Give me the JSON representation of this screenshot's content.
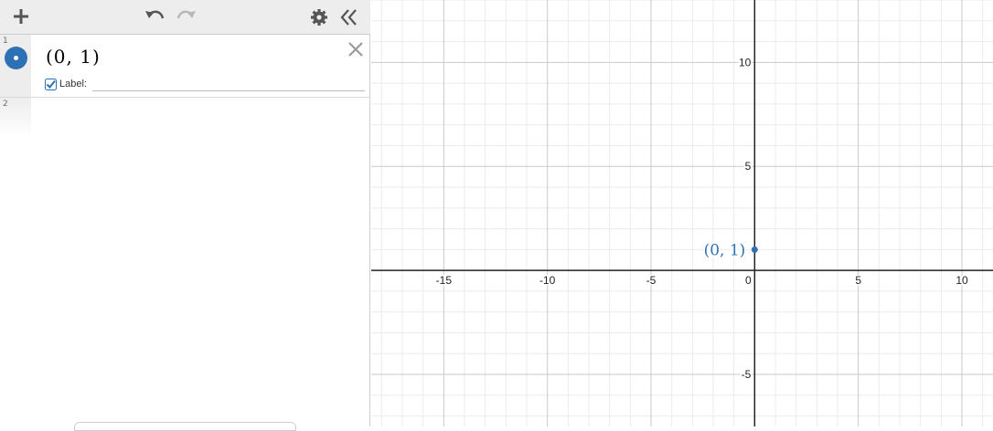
{
  "toolbar": {
    "icons": [
      "plus-icon",
      "undo-icon",
      "redo-icon",
      "gear-icon",
      "collapse-panel-icon"
    ]
  },
  "expressions": [
    {
      "index": "1",
      "latex_display": "(0, 1)",
      "label_checkbox_checked": true,
      "label_caption": "Label:",
      "label_value": "",
      "color": "#2d70b3"
    },
    {
      "index": "2",
      "latex_display": ""
    }
  ],
  "graph": {
    "x_ticks": [
      "-15",
      "-10",
      "-5",
      "0",
      "5",
      "10"
    ],
    "y_ticks": [
      "10",
      "5",
      "-5"
    ],
    "point_label": "(0, 1)",
    "point_color": "#2d70b3",
    "axis_color": "#222222",
    "major_grid_color": "#c9c9c9",
    "minor_grid_color": "#ebebeb"
  },
  "chart_data": {
    "type": "scatter",
    "points": [
      {
        "x": 0,
        "y": 1,
        "label": "(0, 1)"
      }
    ],
    "xlim": [
      -18.5,
      11.5
    ],
    "ylim": [
      -7.5,
      13
    ],
    "xticks": [
      -15,
      -10,
      -5,
      0,
      5,
      10
    ],
    "yticks": [
      -5,
      5,
      10
    ],
    "grid": true,
    "title": "",
    "xlabel": "",
    "ylabel": ""
  }
}
